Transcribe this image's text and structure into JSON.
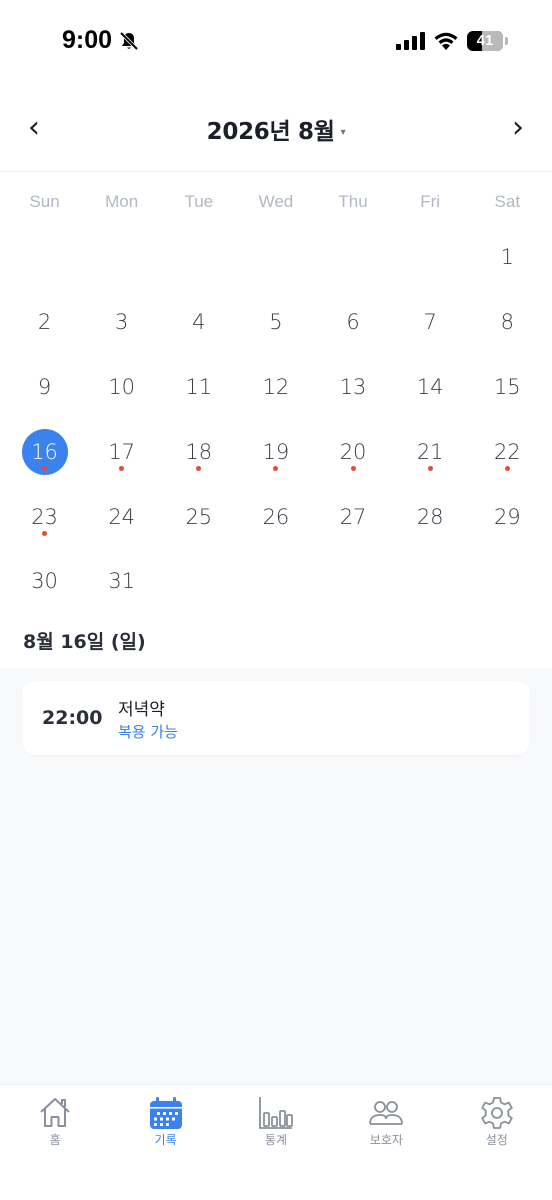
{
  "status_bar": {
    "time": "9:00",
    "battery": "41"
  },
  "header": {
    "month_title": "2026년 8월",
    "caret": "▾",
    "prev": "‹",
    "next": "›"
  },
  "weekdays": [
    "Sun",
    "Mon",
    "Tue",
    "Wed",
    "Thu",
    "Fri",
    "Sat"
  ],
  "calendar": {
    "weeks": [
      [
        "",
        "",
        "",
        "",
        "",
        "",
        "1"
      ],
      [
        "2",
        "3",
        "4",
        "5",
        "6",
        "7",
        "8"
      ],
      [
        "9",
        "10",
        "11",
        "12",
        "13",
        "14",
        "15"
      ],
      [
        "16",
        "17",
        "18",
        "19",
        "20",
        "21",
        "22"
      ],
      [
        "23",
        "24",
        "25",
        "26",
        "27",
        "28",
        "29"
      ],
      [
        "30",
        "31",
        "",
        "",
        "",
        "",
        ""
      ]
    ],
    "selected_day": "16",
    "marked_days": [
      "16",
      "17",
      "18",
      "19",
      "20",
      "21",
      "22",
      "23"
    ]
  },
  "selected_date_label": "8월 16일 (일)",
  "schedule": [
    {
      "time": "22:00",
      "title": "저녁약",
      "status": "복용 가능"
    }
  ],
  "tabs": [
    {
      "label": "홈",
      "icon": "home-icon",
      "active": false
    },
    {
      "label": "기록",
      "icon": "calendar-icon",
      "active": true
    },
    {
      "label": "통계",
      "icon": "bar-chart-icon",
      "active": false
    },
    {
      "label": "보호자",
      "icon": "guardians-icon",
      "active": false
    },
    {
      "label": "설정",
      "icon": "gear-icon",
      "active": false
    }
  ],
  "colors": {
    "accent": "#3b82ee",
    "dot": "#e24a3b",
    "inactive": "#8a909b"
  }
}
